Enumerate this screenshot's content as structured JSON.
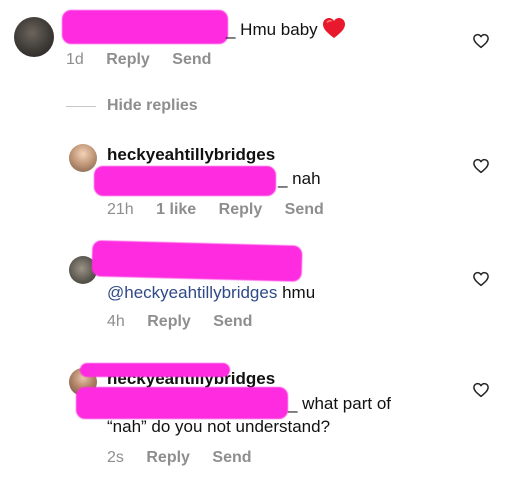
{
  "top_comment": {
    "text": "_ Hmu baby",
    "emoji": "red-heart",
    "time": "1d",
    "reply_label": "Reply",
    "send_label": "Send"
  },
  "hide_replies_label": "Hide replies",
  "replies": [
    {
      "username": "heckyeahtillybridges",
      "text": "_ nah",
      "time": "21h",
      "likes": "1 like",
      "reply_label": "Reply",
      "send_label": "Send"
    },
    {
      "mention": "@heckyeahtillybridges",
      "text": "hmu",
      "time": "4h",
      "reply_label": "Reply",
      "send_label": "Send"
    },
    {
      "username": "heckyeahtillybridges",
      "text_line1": "_ what part of",
      "text_line2": "“nah” do you not understand?",
      "time": "2s",
      "reply_label": "Reply",
      "send_label": "Send"
    }
  ],
  "colors": {
    "redaction": "#ff2be0",
    "meta": "#8e8e8e",
    "mention": "#2f4a86",
    "emoji_heart": "#e8192c"
  },
  "icons": {
    "like": "heart-outline-icon",
    "emoji": "red-heart-emoji-icon"
  }
}
